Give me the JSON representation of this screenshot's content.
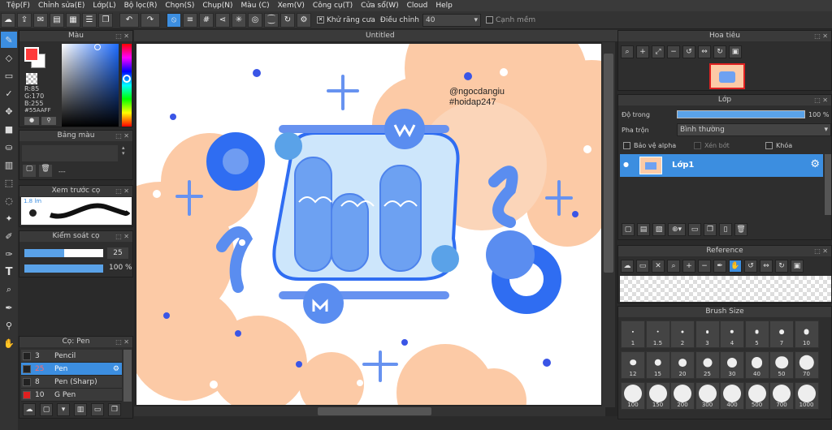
{
  "menu": [
    "Tệp(F)",
    "Chỉnh sửa(E)",
    "Lớp(L)",
    "Bộ lọc(R)",
    "Chọn(S)",
    "Chụp(N)",
    "Màu (C)",
    "Xem(V)",
    "Công cụ(T)",
    "Cửa sổ(W)",
    "Cloud",
    "Help"
  ],
  "toolbar": {
    "antialias_label": "Khử răng cưa",
    "adjust_label": "Điều chỉnh",
    "adjust_value": "40",
    "edge_label": "Cạnh mềm"
  },
  "color_panel": {
    "title": "Màu",
    "r": "R:85",
    "g": "G:170",
    "b": "B:255",
    "hex": "#55AAFF",
    "accent": "#55AAFF"
  },
  "palette_panel": {
    "title": "Bảng màu",
    "dash": "---"
  },
  "preview_panel": {
    "title": "Xem trước cọ",
    "size": "1.8 lm"
  },
  "brush_control": {
    "title": "Kiểm soát cọ",
    "size": "25",
    "opacity": "100 %",
    "opacity_fraction": 1.0,
    "size_fraction": 0.5
  },
  "brush_panel": {
    "title": "Cọ: Pen",
    "items": [
      {
        "size": "3",
        "name": "Pencil",
        "selected": false
      },
      {
        "size": "25",
        "name": "Pen",
        "selected": true
      },
      {
        "size": "8",
        "name": "Pen (Sharp)",
        "selected": false
      },
      {
        "size": "10",
        "name": "G Pen",
        "selected": false
      }
    ]
  },
  "canvas": {
    "tab_title": "Untitled",
    "watermark_user": "@ngocdangiu",
    "watermark_tag": "#hoidap247"
  },
  "navigator": {
    "title": "Hoa tiêu"
  },
  "layer_panel": {
    "title": "Lớp",
    "opacity_label": "Độ trong",
    "opacity_value": "100 %",
    "opacity_fraction": 1.0,
    "blend_label": "Pha trộn",
    "blend_value": "Bình thường",
    "protect_alpha": "Bảo vệ alpha",
    "clip": "Xén bớt",
    "lock": "Khóa",
    "layer_name": "Lớp1"
  },
  "reference": {
    "title": "Reference"
  },
  "brush_size": {
    "title": "Brush Size",
    "sizes": [
      "1",
      "1.5",
      "2",
      "3",
      "4",
      "5",
      "7",
      "10",
      "12",
      "15",
      "20",
      "25",
      "30",
      "40",
      "50",
      "70",
      "100",
      "150",
      "200",
      "300",
      "400",
      "500",
      "700",
      "1000"
    ]
  }
}
